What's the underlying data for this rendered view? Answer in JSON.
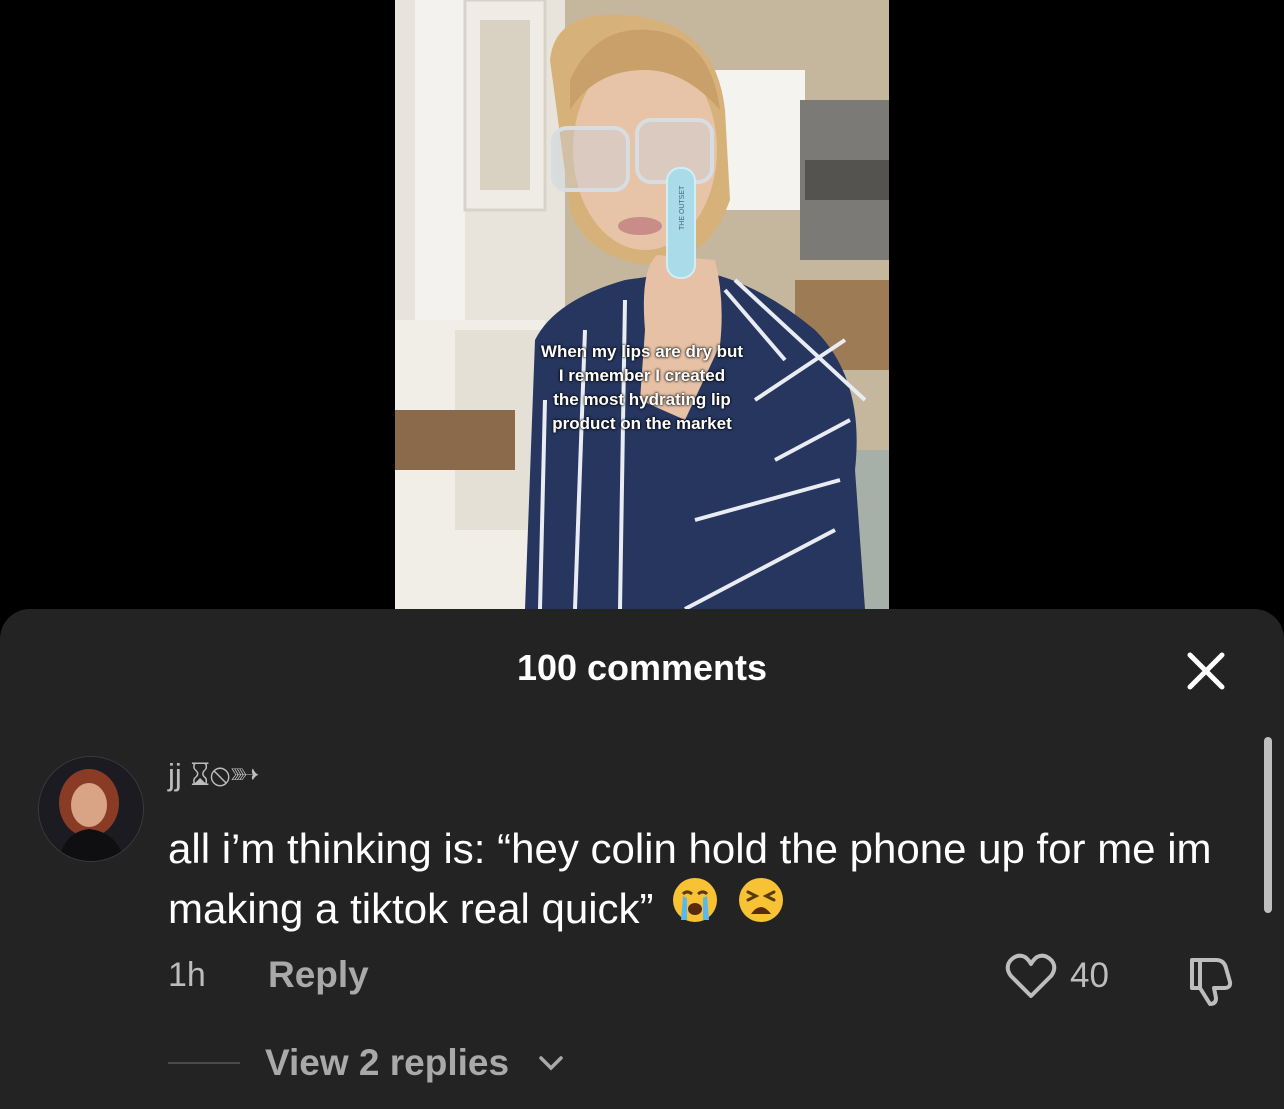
{
  "video": {
    "caption_lines": [
      "When my lips are dry but",
      "I remember I created",
      "the most hydrating lip",
      "product on the market"
    ],
    "product_text": "THE OUTSET"
  },
  "comments": {
    "title": "100 comments",
    "items": [
      {
        "username": "jj ⌛︎⦸➳",
        "text": "all i’m thinking is: “hey colin hold the phone up for me im making a tiktok real quick”",
        "emojis": [
          "😭",
          "😫"
        ],
        "time": "1h",
        "reply_label": "Reply",
        "likes": "40",
        "view_replies_label": "View 2 replies"
      }
    ]
  },
  "colors": {
    "sheet_bg": "#232323",
    "muted_text": "#bdbdbd"
  }
}
